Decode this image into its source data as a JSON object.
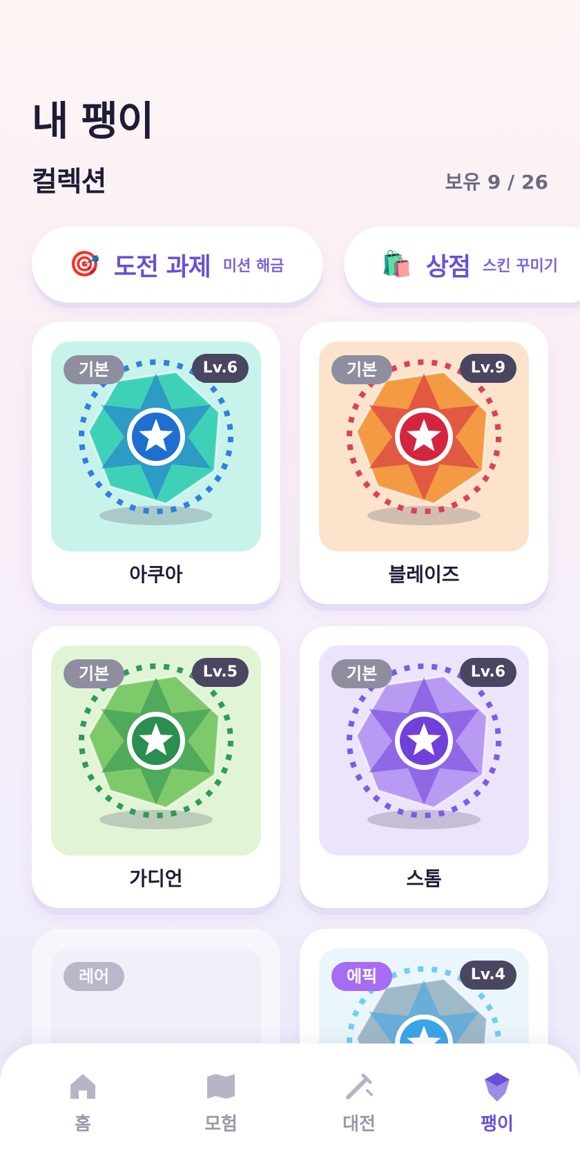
{
  "header": {
    "title": "내 팽이"
  },
  "collection": {
    "title": "컬렉션",
    "owned": "보유 9 / 26"
  },
  "actions": [
    {
      "emoji": "🎯",
      "title": "도전 과제",
      "subtitle": "미션 해금"
    },
    {
      "emoji": "🛍️",
      "title": "상점",
      "subtitle": "스킨 꾸미기"
    }
  ],
  "cards": [
    {
      "name": "아쿠아",
      "tag": "기본",
      "level": "Lv.6",
      "bg": "#c8f3ea",
      "ring": "#2f7fe0",
      "body": "#3ed1b8",
      "core": "#1f6fd0"
    },
    {
      "name": "블레이즈",
      "tag": "기본",
      "level": "Lv.9",
      "bg": "#fde3cc",
      "ring": "#d9415a",
      "body": "#f39a43",
      "core": "#d4253f"
    },
    {
      "name": "가디언",
      "tag": "기본",
      "level": "Lv.5",
      "bg": "#e1f5d6",
      "ring": "#2f9a5a",
      "body": "#7ec96a",
      "core": "#2a8f4e"
    },
    {
      "name": "스톰",
      "tag": "기본",
      "level": "Lv.6",
      "bg": "#ece4fb",
      "ring": "#7f5ae6",
      "body": "#b89af3",
      "core": "#7040d8"
    },
    {
      "name": "",
      "tag": "레어",
      "level": "",
      "bg": "#f3f3f7"
    },
    {
      "name": "",
      "tag": "에픽",
      "level": "Lv.4",
      "bg": "#eaf6fb",
      "ring": "#6fcff0",
      "body": "#9fb9c8",
      "core": "#3aa5e6"
    }
  ],
  "nav": [
    {
      "icon": "home-icon",
      "label": "홈"
    },
    {
      "icon": "map-icon",
      "label": "모험"
    },
    {
      "icon": "battle-icon",
      "label": "대전"
    },
    {
      "icon": "top-icon",
      "label": "팽이"
    }
  ]
}
